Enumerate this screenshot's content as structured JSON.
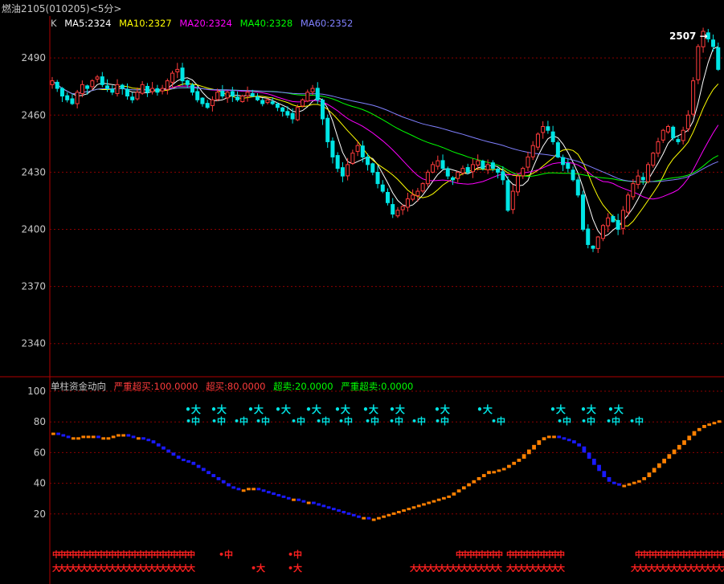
{
  "title": "燃油2105(010205)<5分>",
  "legend_top": {
    "k": "K",
    "ma5": "MA5:2324",
    "ma10": "MA10:2327",
    "ma20": "MA20:2324",
    "ma40": "MA40:2328",
    "ma60": "MA60:2352"
  },
  "legend_bottom": {
    "name": "单柱资金动向",
    "severe_overbought": "严重超买:100.0000",
    "overbought": "超买:80.0000",
    "oversold": "超卖:20.0000",
    "severe_oversold": "严重超卖:0.0000"
  },
  "price_labels": [
    "2490",
    "2460",
    "2430",
    "2400",
    "2370",
    "2340"
  ],
  "price_ticks": [
    2490,
    2460,
    2430,
    2400,
    2370,
    2340
  ],
  "osc_labels": [
    "100",
    "80",
    "60",
    "40",
    "20"
  ],
  "osc_ticks": [
    100,
    80,
    60,
    40,
    20
  ],
  "high_marker": "2507",
  "signal_big": "大",
  "signal_mid": "中",
  "colors": {
    "up": "#ff3c3c",
    "down": "#00e5e5",
    "grid": "#8b0000",
    "ma5": "#ffffff",
    "ma10": "#ffff00",
    "ma20": "#ff00ff",
    "ma40": "#00ff00",
    "ma60": "#8080ff",
    "osc_up": "#ff8000",
    "osc_down": "#1a1aff"
  },
  "chart_data": {
    "type": "candlestick",
    "ylim": [
      2323,
      2512
    ],
    "closes": [
      2478,
      2474,
      2470,
      2468,
      2466,
      2472,
      2476,
      2474,
      2478,
      2480,
      2476,
      2474,
      2472,
      2476,
      2474,
      2470,
      2468,
      2472,
      2476,
      2472,
      2474,
      2472,
      2474,
      2478,
      2482,
      2484,
      2478,
      2476,
      2472,
      2468,
      2466,
      2464,
      2468,
      2472,
      2470,
      2472,
      2470,
      2468,
      2470,
      2472,
      2470,
      2468,
      2466,
      2468,
      2466,
      2464,
      2462,
      2460,
      2458,
      2464,
      2468,
      2472,
      2474,
      2468,
      2458,
      2446,
      2438,
      2432,
      2428,
      2434,
      2440,
      2444,
      2438,
      2434,
      2430,
      2424,
      2420,
      2414,
      2408,
      2410,
      2412,
      2416,
      2418,
      2420,
      2424,
      2430,
      2434,
      2436,
      2432,
      2428,
      2426,
      2430,
      2432,
      2430,
      2434,
      2436,
      2432,
      2434,
      2432,
      2430,
      2426,
      2410,
      2420,
      2428,
      2432,
      2438,
      2444,
      2450,
      2454,
      2452,
      2446,
      2438,
      2434,
      2432,
      2426,
      2418,
      2400,
      2392,
      2390,
      2396,
      2402,
      2406,
      2404,
      2400,
      2410,
      2418,
      2424,
      2428,
      2426,
      2434,
      2440,
      2446,
      2452,
      2454,
      2448,
      2446,
      2452,
      2460,
      2478,
      2496,
      2504,
      2500,
      2496,
      2484
    ],
    "ma_current": {
      "ma5": 2324,
      "ma10": 2327,
      "ma20": 2324,
      "ma40": 2328,
      "ma60": 2352
    },
    "high_marker": 2507,
    "oscillator": {
      "ylim": [
        0,
        100
      ],
      "values": [
        73,
        72,
        71,
        70,
        70,
        70,
        71,
        71,
        71,
        70,
        70,
        70,
        71,
        72,
        72,
        71,
        70,
        70,
        69,
        68,
        66,
        64,
        62,
        60,
        58,
        56,
        55,
        54,
        52,
        50,
        48,
        46,
        44,
        42,
        40,
        38,
        37,
        36,
        36,
        37,
        37,
        36,
        35,
        34,
        33,
        32,
        31,
        30,
        30,
        29,
        28,
        28,
        27,
        26,
        25,
        24,
        23,
        22,
        21,
        20,
        19,
        18,
        18,
        17,
        17,
        18,
        19,
        20,
        21,
        22,
        23,
        24,
        25,
        26,
        27,
        28,
        29,
        30,
        31,
        32,
        34,
        36,
        38,
        40,
        42,
        44,
        46,
        48,
        48,
        49,
        50,
        52,
        54,
        56,
        59,
        62,
        65,
        68,
        70,
        71,
        71,
        70,
        69,
        68,
        66,
        64,
        60,
        56,
        52,
        48,
        44,
        41,
        40,
        39,
        39,
        40,
        41,
        42,
        44,
        47,
        50,
        53,
        56,
        59,
        62,
        65,
        68,
        71,
        74,
        76,
        78,
        79,
        80,
        81
      ]
    }
  }
}
